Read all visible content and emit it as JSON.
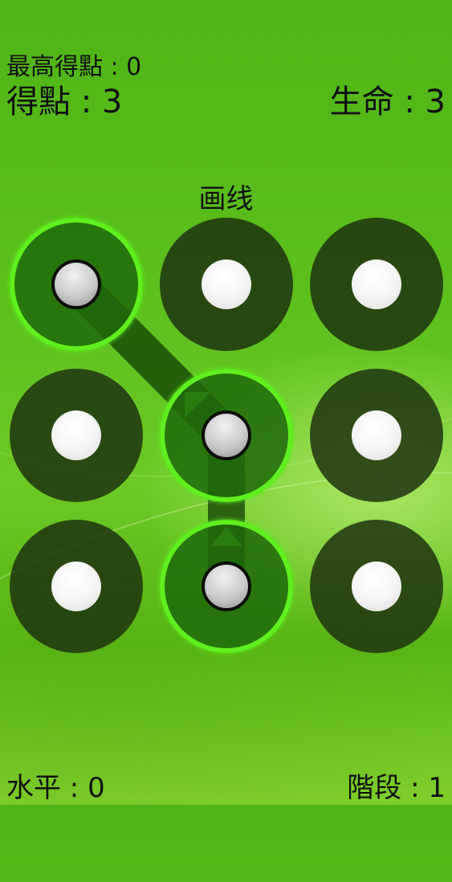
{
  "hud": {
    "high_score": "最高得點 : 0",
    "score": "得點 : 3",
    "lives": "生命 : 3",
    "level": "水平 : 0",
    "stage": "階段 : 1"
  },
  "hint": "画线",
  "grid": {
    "rows": 3,
    "cols": 3,
    "selected_sequence": [
      1,
      5,
      8
    ]
  },
  "colors": {
    "active_ring": "#5ef01e",
    "inactive_node": "#1e320f",
    "path": "#0f3d05"
  }
}
